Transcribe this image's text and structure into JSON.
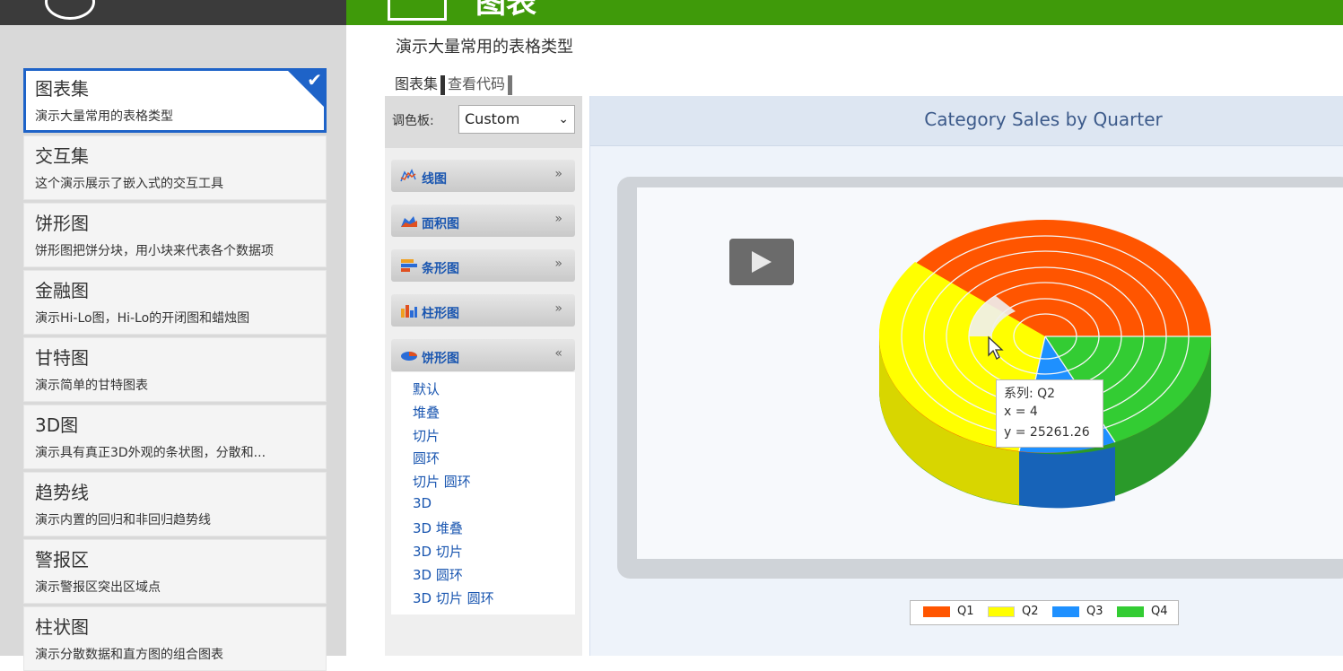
{
  "app": {
    "top_title": "图表",
    "page_subtitle": "演示大量常用的表格类型"
  },
  "sidebar": {
    "items": [
      {
        "title": "图表集",
        "desc": "演示大量常用的表格类型",
        "active": true
      },
      {
        "title": "交互集",
        "desc": "这个演示展示了嵌入式的交互工具"
      },
      {
        "title": "饼形图",
        "desc": "饼形图把饼分块，用小块来代表各个数据项"
      },
      {
        "title": "金融图",
        "desc": "演示Hi-Lo图，Hi-Lo的开闭图和蜡烛图"
      },
      {
        "title": "甘特图",
        "desc": "演示简单的甘特图表"
      },
      {
        "title": "3D图",
        "desc": "演示具有真正3D外观的条状图，分散和..."
      },
      {
        "title": "趋势线",
        "desc": "演示内置的回归和非回归趋势线"
      },
      {
        "title": "警报区",
        "desc": "演示警报区突出区域点"
      },
      {
        "title": "柱状图",
        "desc": "演示分散数据和直方图的组合图表"
      }
    ]
  },
  "tabs": {
    "gallery": "图表集",
    "view_code": "查看代码"
  },
  "palette": {
    "label": "调色板:",
    "selected": "Custom"
  },
  "accordion": {
    "groups": [
      {
        "label": "线图",
        "icon": "line-chart-icon",
        "expanded": false
      },
      {
        "label": "面积图",
        "icon": "area-chart-icon",
        "expanded": false
      },
      {
        "label": "条形图",
        "icon": "bar-chart-icon",
        "expanded": false
      },
      {
        "label": "柱形图",
        "icon": "column-chart-icon",
        "expanded": false
      },
      {
        "label": "饼形图",
        "icon": "pie-chart-icon",
        "expanded": true
      }
    ],
    "pie_items": [
      "默认",
      "堆叠",
      "切片",
      "圆环",
      "切片 圆环",
      "3D",
      "3D 堆叠",
      "3D 切片",
      "3D 圆环",
      "3D 切片 圆环"
    ]
  },
  "chart": {
    "title": "Category Sales by Quarter",
    "legend": [
      {
        "name": "Q1",
        "color": "#ff5500"
      },
      {
        "name": "Q2",
        "color": "#ffff00"
      },
      {
        "name": "Q3",
        "color": "#1e90ff"
      },
      {
        "name": "Q4",
        "color": "#33cc33"
      }
    ],
    "tooltip": {
      "line1": "系列: Q2",
      "line2": "x = 4",
      "line3": "y = 25261.26"
    }
  },
  "colors": {
    "accent_green": "#3f9a0a",
    "active_blue": "#1e63c8",
    "link_blue": "#1a56b0"
  }
}
